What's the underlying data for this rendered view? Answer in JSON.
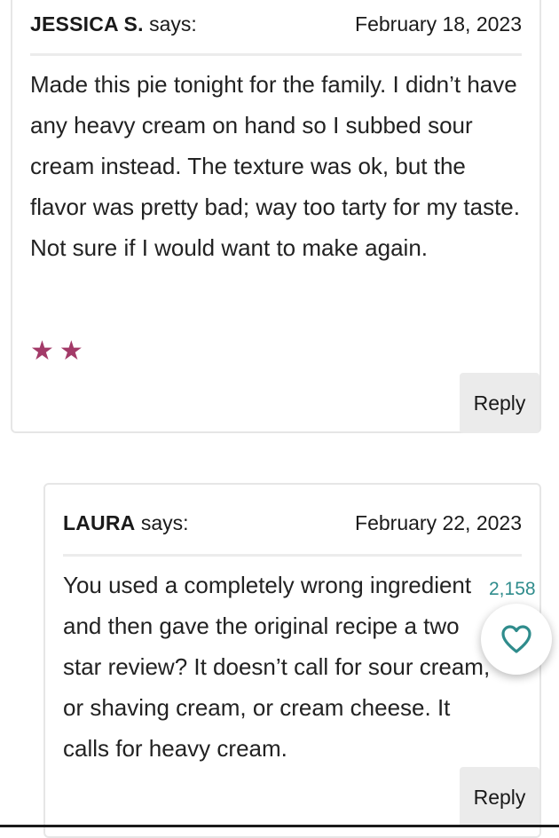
{
  "comments": [
    {
      "author": "JESSICA S.",
      "says": "says:",
      "date": "February 18, 2023",
      "body": "Made this pie tonight for the family. I didn’t have any heavy cream on hand so I subbed sour cream instead. The texture was ok, but the flavor was pretty bad; way too tarty for my taste. Not sure if I would want to make again.",
      "rating": 2,
      "rating_glyphs": "★★",
      "reply_label": "Reply"
    },
    {
      "author": "LAURA",
      "says": "says:",
      "date": "February 22, 2023",
      "body": "You used a completely wrong ingredient and then gave the original recipe a two star review? It doesn’t call for sour cream, or shaving cream, or cream cheese. It calls for heavy cream.",
      "reply_label": "Reply"
    }
  ],
  "like_widget": {
    "count": "2,158",
    "icon": "heart-icon",
    "color": "#2f8c8c"
  },
  "colors": {
    "star": "#a33a68",
    "reply_bg": "#ebebeb",
    "card_border": "#e6e6e6"
  }
}
